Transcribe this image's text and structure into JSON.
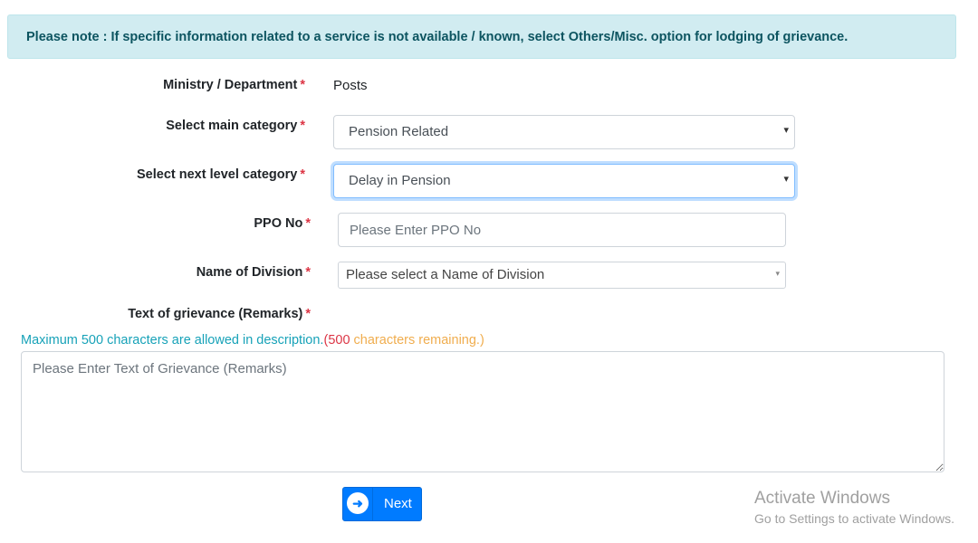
{
  "note": "Please note : If specific information related to a service is not available / known, select Others/Misc. option for lodging of grievance.",
  "required_mark": "*",
  "fields": {
    "ministry": {
      "label": "Ministry / Department",
      "value": "Posts"
    },
    "main_category": {
      "label": "Select main category",
      "value": "Pension Related"
    },
    "next_category": {
      "label": "Select next level category",
      "value": "Delay in Pension"
    },
    "ppo": {
      "label": "PPO No",
      "placeholder": "Please Enter PPO No",
      "value": ""
    },
    "division": {
      "label": "Name of Division",
      "value": "Please select a Name of Division"
    },
    "grievance": {
      "label": "Text of grievance (Remarks)",
      "placeholder": "Please Enter Text of Grievance (Remarks)",
      "value": ""
    }
  },
  "char_hint": {
    "prefix": "Maximum 500 characters are allowed in description.",
    "open": "(",
    "count": "500",
    "suffix": " characters remaining.)"
  },
  "icons": {
    "caret": "▾",
    "next": "➜"
  },
  "next_button": {
    "label": "Next"
  },
  "watermark": {
    "title": "Activate Windows",
    "subtitle": "Go to Settings to activate Windows."
  },
  "colors": {
    "primary": "#007bff",
    "info": "#17a2b8",
    "danger": "#dc3545",
    "warning": "#f0ad4e"
  }
}
